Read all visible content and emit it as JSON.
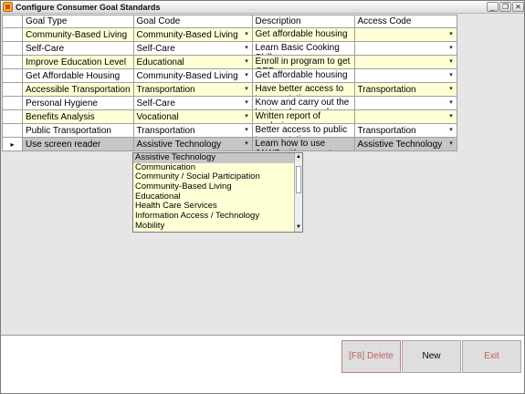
{
  "window": {
    "title": "Configure Consumer Goal Standards"
  },
  "grid": {
    "columns": [
      "Goal Type",
      "Goal Code",
      "Description",
      "Access Code"
    ],
    "rows": [
      {
        "goal_type": "Community-Based Living",
        "goal_code": "Community-Based Living",
        "description": "Get affordable housing",
        "access_code": ""
      },
      {
        "goal_type": "Self-Care",
        "goal_code": "Self-Care",
        "description": "Learn Basic Cooking Skills",
        "access_code": ""
      },
      {
        "goal_type": "Improve Education Level",
        "goal_code": "Educational",
        "description": "Enroll in program to get GED",
        "access_code": ""
      },
      {
        "goal_type": "Get Affordable Housing",
        "goal_code": "Community-Based Living",
        "description": "Get affordable housing",
        "access_code": ""
      },
      {
        "goal_type": "Accessible Transportation",
        "goal_code": "Transportation",
        "description": "Have better access to transportation",
        "access_code": "Transportation"
      },
      {
        "goal_type": "Personal Hygiene",
        "goal_code": "Self-Care",
        "description": "Know and carry out the basics of personal",
        "access_code": ""
      },
      {
        "goal_type": "Benefits Analysis",
        "goal_code": "Vocational",
        "description": "Written report of analysis",
        "access_code": ""
      },
      {
        "goal_type": "Public Transportation",
        "goal_code": "Transportation",
        "description": "Better access to public transportation",
        "access_code": "Transportation"
      },
      {
        "goal_type": "Use screen reader",
        "goal_code": "Assistive Technology",
        "description": "Learn how to use JAWS with computer",
        "access_code": "Assistive Technology"
      }
    ],
    "selected_row_marker": "▸"
  },
  "dropdown": {
    "options": [
      "Assistive Technology",
      "Communication",
      "Community / Social Participation",
      "Community-Based Living",
      "Educational",
      "Health Care Services",
      "Information Access / Technology",
      "Mobility"
    ],
    "highlighted": "Assistive Technology"
  },
  "buttons": {
    "delete": "[F8] Delete",
    "new": "New",
    "exit": "Exit"
  },
  "colors": {
    "row_alt": "#ffffd6",
    "row_selected": "#c6c6c6",
    "delete_text": "#c06060"
  }
}
